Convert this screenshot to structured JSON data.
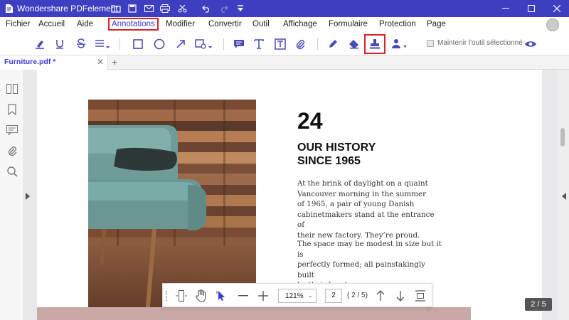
{
  "app": {
    "title": "Wondershare PDFelement"
  },
  "menu": {
    "items": [
      "Fichier",
      "Accueil",
      "Aide",
      "Annotations",
      "Modifier",
      "Convertir",
      "Outil",
      "Affichage",
      "Formulaire",
      "Protection",
      "Page"
    ],
    "active": "Annotations"
  },
  "toolbar": {
    "keep_tool_label": "Maintenir l'outil sélectionné",
    "highlighted_tool": "stamp-icon"
  },
  "tabs": [
    {
      "label": "Furniture.pdf *",
      "active": true
    }
  ],
  "document": {
    "number": "24",
    "title_line1": "OUR HISTORY",
    "title_line2": "SINCE 1965",
    "para1": [
      "At the brink of daylight on a quaint",
      "Vancouver morning in the summer",
      "of 1965, a pair of young Danish",
      "cabinetmakers stand at the entrance of",
      "their new factory. They’re proud."
    ],
    "para2": [
      "The space may be modest in size but it is",
      "perfectly formed; all painstakingly built",
      "by their hands."
    ]
  },
  "navbar": {
    "zoom": "121%",
    "current_page": "2",
    "page_count": "( 2 / 5)"
  },
  "page_indicator": "2 / 5",
  "colors": {
    "titlebar": "#3e3ec0",
    "accent": "#3a3ad0",
    "highlight_box": "#d4242b",
    "tool_icon": "#4a4ab8"
  }
}
